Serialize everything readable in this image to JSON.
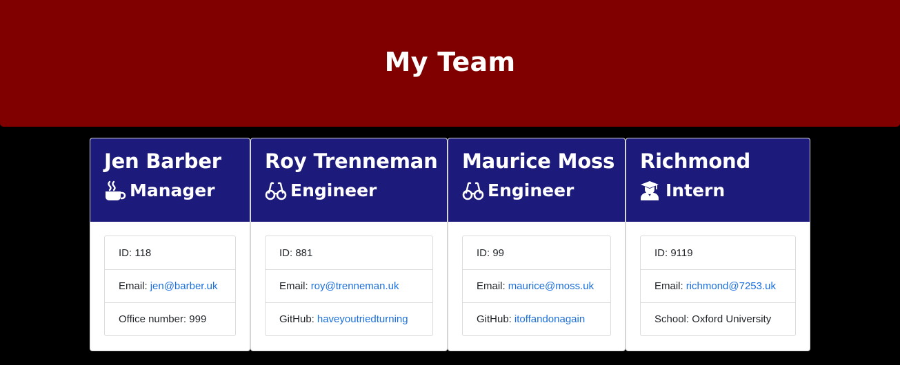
{
  "header": {
    "title": "My Team"
  },
  "colors": {
    "banner": "#800000",
    "card_header": "#1c1a7b",
    "link": "#1a6fe0"
  },
  "cards": [
    {
      "name": "Jen Barber",
      "role": "Manager",
      "role_icon": "mug-hot-icon",
      "id_label": "ID: 118",
      "email_label": "Email:",
      "email": "jen@barber.uk",
      "extra_label": "Office number: 999",
      "extra_link": ""
    },
    {
      "name": "Roy Trenneman",
      "role": "Engineer",
      "role_icon": "glasses-icon",
      "id_label": "ID: 881",
      "email_label": "Email:",
      "email": "roy@trenneman.uk",
      "extra_label": "GitHub:",
      "extra_link": "haveyoutriedturning"
    },
    {
      "name": "Maurice Moss",
      "role": "Engineer",
      "role_icon": "glasses-icon",
      "id_label": "ID: 99",
      "email_label": "Email:",
      "email": "maurice@moss.uk",
      "extra_label": "GitHub:",
      "extra_link": "itoffandonagain"
    },
    {
      "name": "Richmond",
      "role": "Intern",
      "role_icon": "user-graduate-icon",
      "id_label": "ID: 9119",
      "email_label": "Email:",
      "email": "richmond@7253.uk",
      "extra_label": "School: Oxford University",
      "extra_link": ""
    }
  ]
}
